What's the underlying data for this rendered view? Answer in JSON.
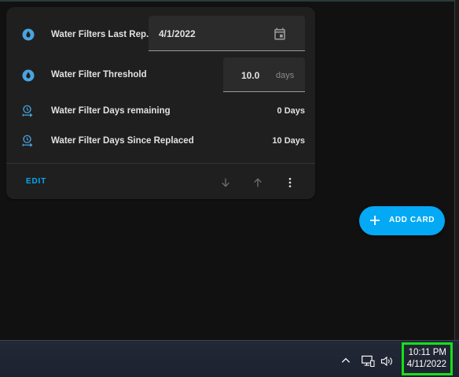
{
  "card": {
    "rows": [
      {
        "label": "Water Filters Last Rep...",
        "icon": "water-drop-icon"
      },
      {
        "label": "Water Filter Threshold",
        "icon": "water-drop-icon"
      },
      {
        "label": "Water Filter Days remaining",
        "icon": "timer-sand-icon",
        "value": "0 Days"
      },
      {
        "label": "Water Filter Days Since Replaced",
        "icon": "timer-sand-icon",
        "value": "10 Days"
      }
    ],
    "date_input": {
      "value": "4/1/2022",
      "icon": "calendar-icon"
    },
    "threshold_input": {
      "value": "10.0",
      "unit": "days"
    },
    "edit_label": "EDIT",
    "actions": [
      "arrow-down-icon",
      "arrow-up-icon",
      "more-vertical-icon"
    ]
  },
  "fab": {
    "label": "ADD CARD",
    "icon": "plus-icon"
  },
  "taskbar": {
    "tray_icons": [
      "chevron-up-icon",
      "network-icon",
      "volume-icon"
    ],
    "time": "10:11 PM",
    "date": "4/11/2022"
  },
  "colors": {
    "accent": "#03a9f4",
    "drop_icon": "#4aa3e0",
    "card_bg": "#1f1f1f",
    "page_bg": "#111111",
    "clock_highlight": "#15e01a"
  }
}
